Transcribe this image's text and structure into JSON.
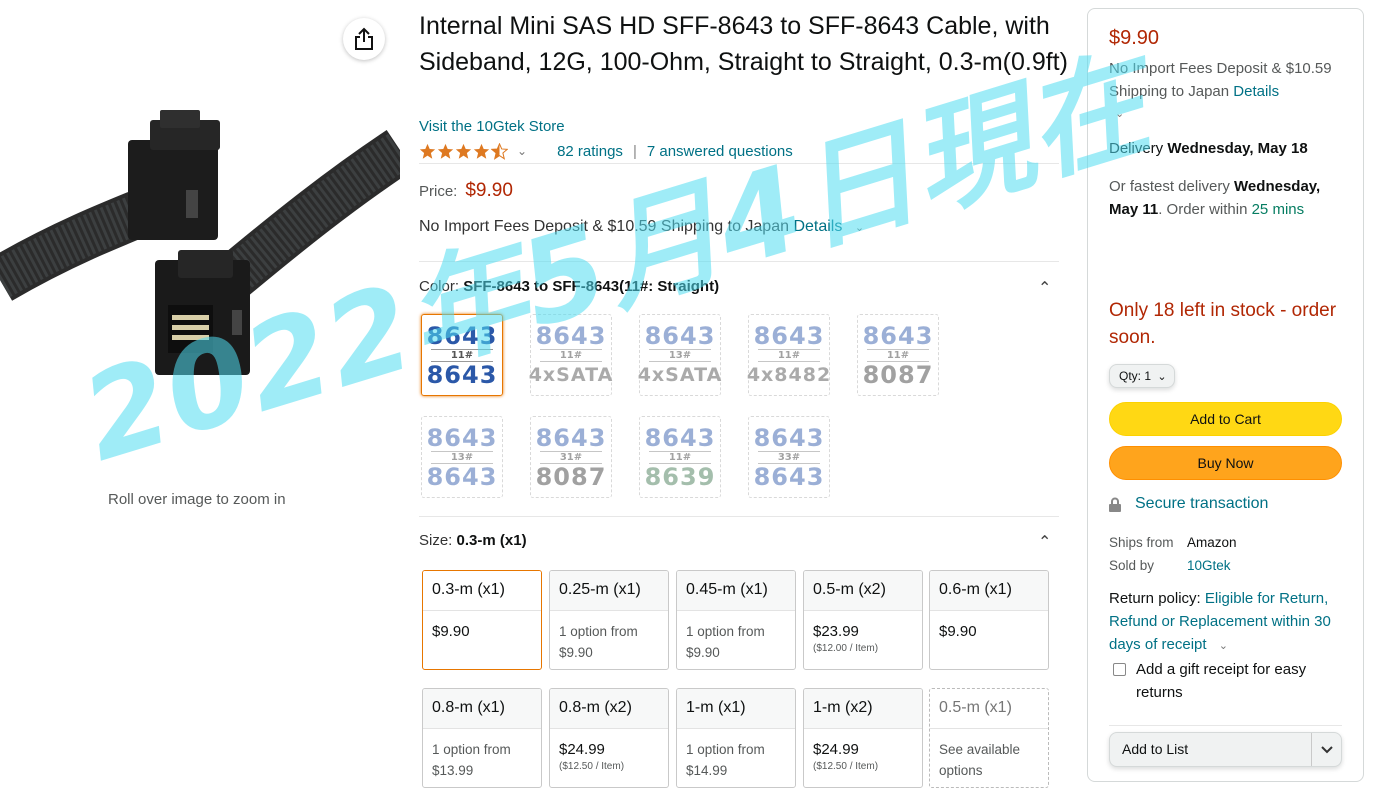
{
  "image": {
    "zoom_hint": "Roll over image to zoom in"
  },
  "product": {
    "title": "Internal Mini SAS HD SFF-8643 to SFF-8643 Cable, with Sideband, 12G, 100-Ohm, Straight to Straight, 0.3-m(0.9ft)",
    "store_link": "Visit the 10Gtek Store",
    "rating_value": 4.5,
    "ratings": "82 ratings",
    "answered": "7 answered questions",
    "price_label": "Price:",
    "price": "$9.90",
    "import_text": "No Import Fees Deposit & $10.59 Shipping to Japan",
    "details_link": "Details"
  },
  "color": {
    "label": "Color:",
    "selected": "SFF-8643 to SFF-8643(11#: Straight)",
    "swatches": [
      {
        "top": "8643",
        "mid": "11#",
        "bot": "8643"
      },
      {
        "top": "8643",
        "mid": "11#",
        "bot": "4xSATA"
      },
      {
        "top": "8643",
        "mid": "13#",
        "bot": "4xSATA"
      },
      {
        "top": "8643",
        "mid": "11#",
        "bot": "4x8482"
      },
      {
        "top": "8643",
        "mid": "11#",
        "bot": "8087"
      },
      {
        "top": "8643",
        "mid": "13#",
        "bot": "8643"
      },
      {
        "top": "8643",
        "mid": "31#",
        "bot": "8087"
      },
      {
        "top": "8643",
        "mid": "11#",
        "bot": "8639"
      },
      {
        "top": "8643",
        "mid": "33#",
        "bot": "8643"
      }
    ]
  },
  "size": {
    "label": "Size:",
    "selected": "0.3-m (x1)",
    "options": [
      {
        "name": "0.3-m (x1)",
        "line1": "$9.90",
        "line2": ""
      },
      {
        "name": "0.25-m (x1)",
        "line1": "1 option from",
        "line2": "$9.90"
      },
      {
        "name": "0.45-m (x1)",
        "line1": "1 option from",
        "line2": "$9.90"
      },
      {
        "name": "0.5-m (x2)",
        "line1": "$23.99",
        "line2": "($12.00 / Item)"
      },
      {
        "name": "0.6-m (x1)",
        "line1": "$9.90",
        "line2": ""
      },
      {
        "name": "0.8-m (x1)",
        "line1": "1 option from",
        "line2": "$13.99"
      },
      {
        "name": "0.8-m (x2)",
        "line1": "$24.99",
        "line2": "($12.50 / Item)"
      },
      {
        "name": "1-m (x1)",
        "line1": "1 option from",
        "line2": "$14.99"
      },
      {
        "name": "1-m (x2)",
        "line1": "$24.99",
        "line2": "($12.50 / Item)"
      },
      {
        "name": "0.5-m (x1)",
        "line1": "See available",
        "line2": "options"
      }
    ]
  },
  "buybox": {
    "price": "$9.90",
    "import_text": "No Import Fees Deposit & $10.59 Shipping to Japan",
    "details_link": "Details",
    "delivery_prefix": "Delivery",
    "delivery_date": "Wednesday, May 18",
    "fastest_prefix": "Or fastest delivery",
    "fastest_date": "Wednesday, May 11",
    "order_within": ". Order within",
    "countdown": "25 mins",
    "stock": "Only 18 left in stock - order soon.",
    "qty": "Qty: 1",
    "add_to_cart": "Add to Cart",
    "buy_now": "Buy Now",
    "secure": "Secure transaction",
    "ships_from_label": "Ships from",
    "ships_from": "Amazon",
    "sold_by_label": "Sold by",
    "sold_by": "10Gtek",
    "return_label": "Return policy:",
    "return_link": "Eligible for Return, Refund or Replacement within 30 days of receipt",
    "gift_receipt": "Add a gift receipt for easy returns",
    "add_to_list": "Add to List"
  },
  "watermark": "2022年5月4日現在"
}
